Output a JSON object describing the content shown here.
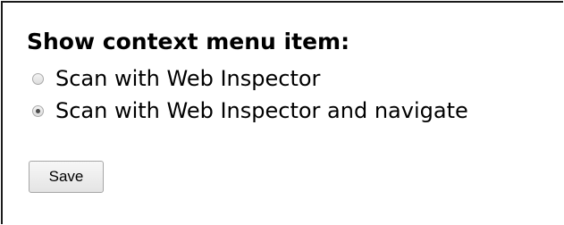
{
  "settings": {
    "heading": "Show context menu item:",
    "options": [
      {
        "label": "Scan with Web Inspector",
        "selected": false
      },
      {
        "label": "Scan with Web Inspector and navigate",
        "selected": true
      }
    ],
    "save_label": "Save"
  }
}
